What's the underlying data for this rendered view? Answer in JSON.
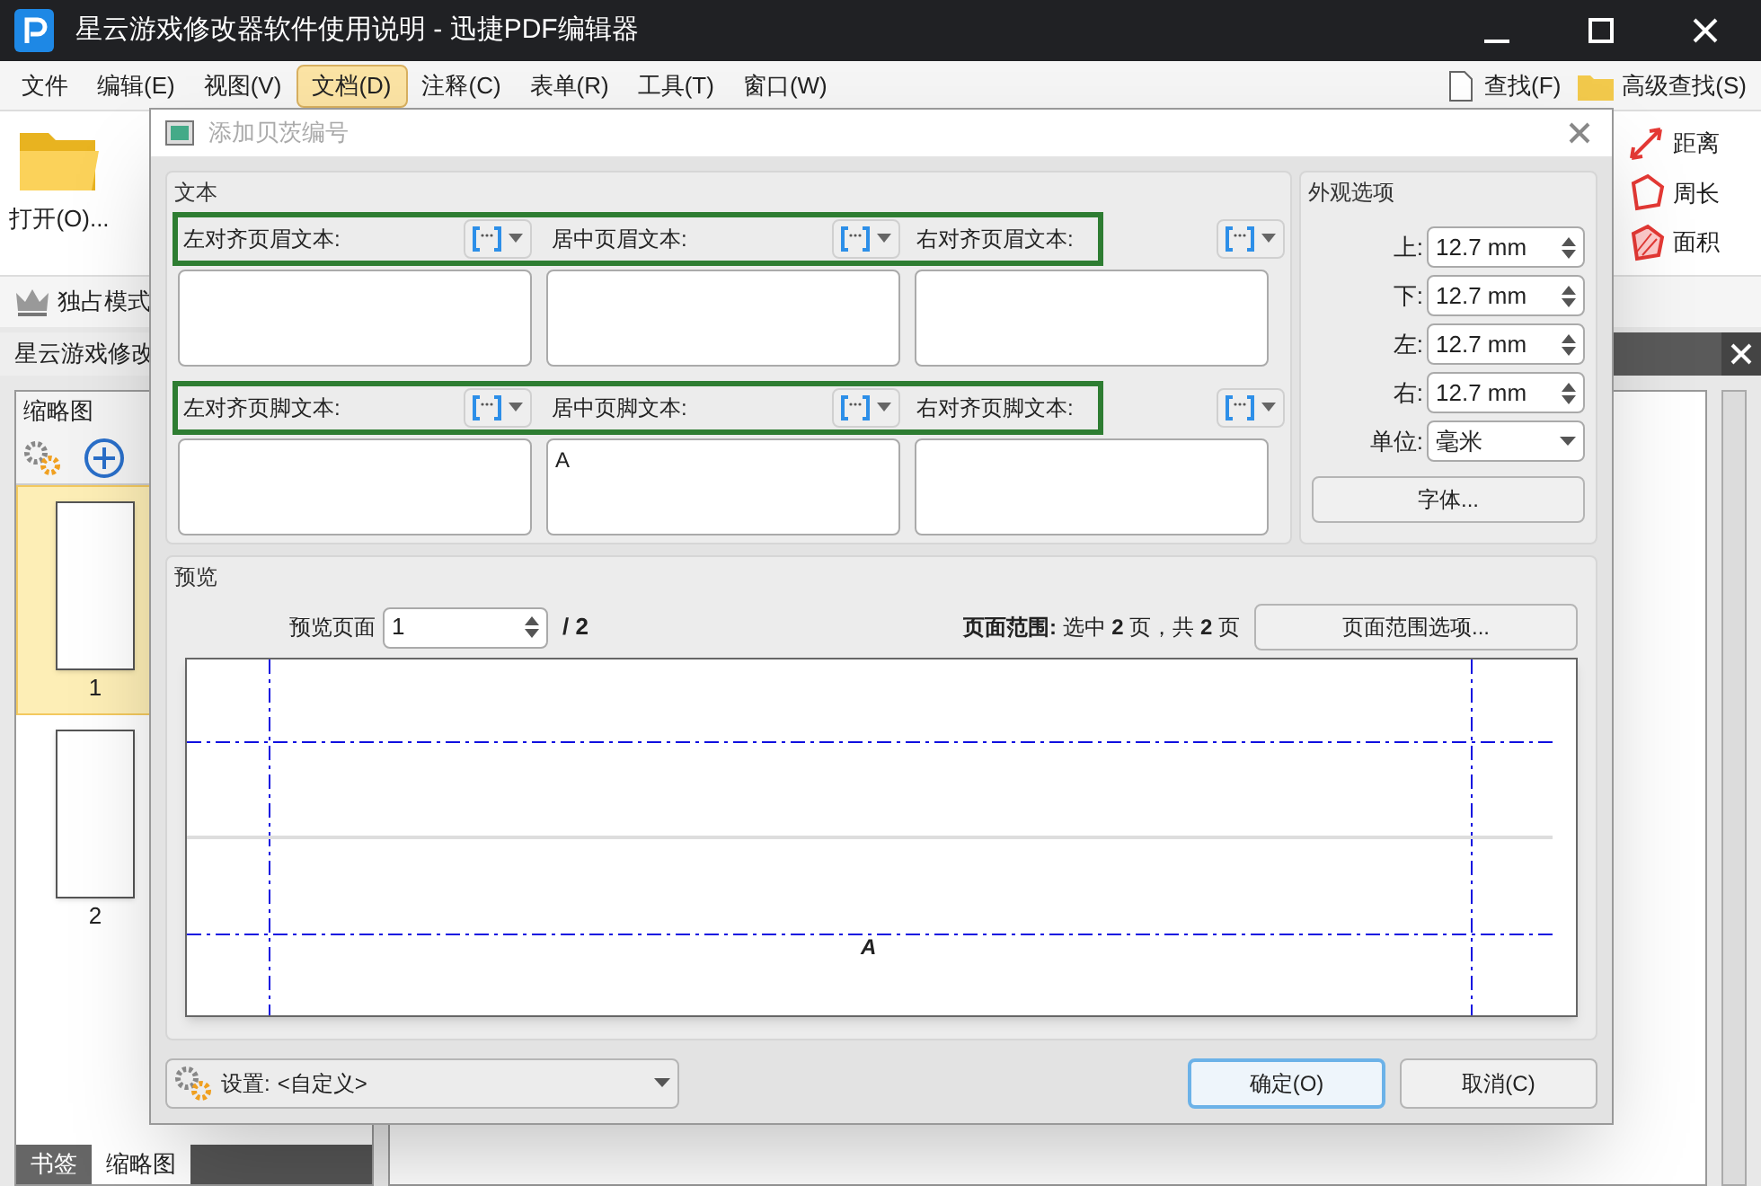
{
  "app": {
    "title": "星云游戏修改器软件使用说明 - 迅捷PDF编辑器",
    "menu": [
      {
        "label": "文件",
        "selected": false
      },
      {
        "label": "编辑(E)",
        "selected": false
      },
      {
        "label": "视图(V)",
        "selected": false
      },
      {
        "label": "文档(D)",
        "selected": true
      },
      {
        "label": "注释(C)",
        "selected": false
      },
      {
        "label": "表单(R)",
        "selected": false
      },
      {
        "label": "工具(T)",
        "selected": false
      },
      {
        "label": "窗口(W)",
        "selected": false
      }
    ],
    "search_tools": [
      {
        "kind": "find",
        "label": "查找(F)"
      },
      {
        "kind": "advanced",
        "label": "高级查找(S)"
      }
    ],
    "open_button": "打开(O)...",
    "exclusive_mode": "独占模式",
    "doc_tab": "星云游戏修改",
    "thumbnail_panel": {
      "title": "缩略图",
      "pages": [
        {
          "label": "1",
          "selected": true
        },
        {
          "label": "2",
          "selected": false
        }
      ]
    },
    "measure_tools": [
      {
        "kind": "distance",
        "label": "距离"
      },
      {
        "kind": "perimeter",
        "label": "周长"
      },
      {
        "kind": "area",
        "label": "面积"
      }
    ],
    "bottom_tabs": [
      {
        "label": "书签",
        "selected": false
      },
      {
        "label": "缩略图",
        "selected": true
      }
    ]
  },
  "dialog": {
    "title": "添加贝茨编号",
    "text_group": {
      "title": "文本",
      "header_fields": [
        {
          "label": "左对齐页眉文本:"
        },
        {
          "label": "居中页眉文本:"
        },
        {
          "label": "右对齐页眉文本:"
        }
      ],
      "footer_fields": [
        {
          "label": "左对齐页脚文本:"
        },
        {
          "label": "居中页脚文本:",
          "value": "A"
        },
        {
          "label": "右对齐页脚文本:"
        }
      ]
    },
    "appearance": {
      "title": "外观选项",
      "margins": [
        {
          "label": "上:",
          "value": "12.7 mm"
        },
        {
          "label": "下:",
          "value": "12.7 mm"
        },
        {
          "label": "左:",
          "value": "12.7 mm"
        },
        {
          "label": "右:",
          "value": "12.7 mm"
        }
      ],
      "unit": {
        "label": "单位:",
        "value": "毫米"
      },
      "font_button": "字体..."
    },
    "preview": {
      "title": "预览",
      "page_label": "预览页面",
      "page_value": "1",
      "page_total": "/ 2",
      "range_text": "**页面范围:** 选中 **2** 页，共 **2** 页",
      "range_button": "页面范围选项...",
      "footer_mark": "A"
    },
    "settings": {
      "label": "设置:",
      "value": "<自定义>"
    },
    "buttons": [
      {
        "label": "确定(O)",
        "selected": true
      },
      {
        "label": "取消(C)",
        "selected": false
      }
    ]
  }
}
